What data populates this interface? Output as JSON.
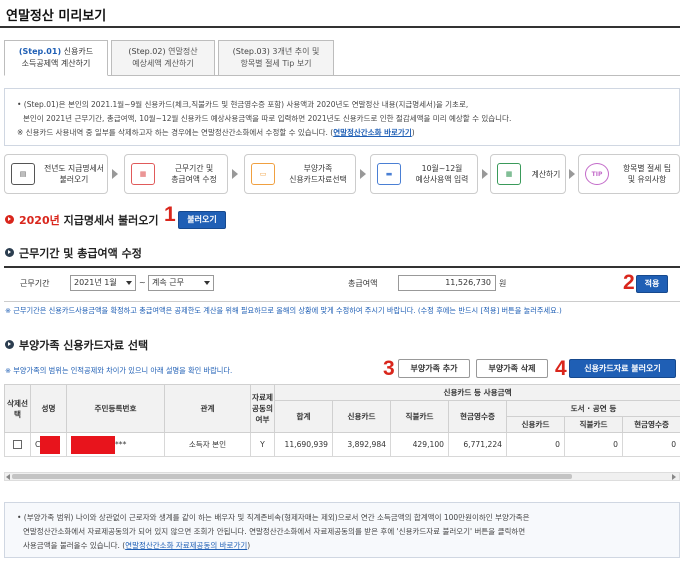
{
  "page": {
    "title": "연말정산 미리보기"
  },
  "tabs": [
    {
      "step": "(Step.01)",
      "label1": "신용카드",
      "label2": "소득공제액 계산하기"
    },
    {
      "step": "(Step.02)",
      "label1": "연말정산",
      "label2": "예상세액 계산하기"
    },
    {
      "step": "(Step.03)",
      "label1": "3개년 추이 및",
      "label2": "항목별 절세 Tip 보기"
    }
  ],
  "info": {
    "line1": "• (Step.01)은 본인의 2021.1월~9월 신용카드(체크,직불카드 및 현금영수증 포함) 사용액과 2020년도 연말정산 내용(지급명세서)을 기초로,",
    "line2": "본인이 2021년 근무기간, 총급여액, 10월~12월 신용카드 예상사용금액을 따로 입력하면 2021년도 신용카드로 인한 절감세액을 미리 예상할 수 있습니다.",
    "line3": "※ 신용카드 사용내역 중 일부를 삭제하고자 하는 경우에는 연말정산간소화에서 수정할 수 있습니다. (",
    "link": "연말정산간소화 바로가기",
    "line3_end": ")"
  },
  "flow": [
    {
      "label1": "전년도 지급명세서",
      "label2": "불러오기",
      "icon": "document-icon",
      "icon_text": "▤",
      "color": "#555555"
    },
    {
      "label1": "근무기간 및",
      "label2": "총급여액 수정",
      "icon": "calendar-icon",
      "icon_text": "▦",
      "color": "#e05a5a"
    },
    {
      "label1": "부양가족",
      "label2": "신용카드자료선택",
      "icon": "monitor-icon",
      "icon_text": "▭",
      "color": "#f0a040"
    },
    {
      "label1": "10월~12월",
      "label2": "예상사용액 입력",
      "icon": "card-icon",
      "icon_text": "▬",
      "color": "#4a7fd4"
    },
    {
      "label1": "계산하기",
      "label2": "",
      "icon": "calculator-icon",
      "icon_text": "▦",
      "color": "#3a9a5a"
    },
    {
      "label1": "항목별 절세 팁",
      "label2": "및 유의사항",
      "icon": "tip-icon",
      "icon_text": "TIP",
      "color": "#c36bc9"
    }
  ],
  "section1": {
    "year": "2020년",
    "title": "지급명세서 불러오기",
    "button": "불러오기",
    "marker": "1"
  },
  "section2": {
    "title": "근무기간 및 총급여액 수정",
    "period_label": "근무기간",
    "period_start": "2021년 1월",
    "tilde": "~",
    "period_end": "계속 근무",
    "salary_label": "총급여액",
    "salary_value": "11,526,730",
    "unit": "원",
    "apply_button": "적용",
    "marker": "2",
    "note": "※ 근무기간은 신용카드사용금액을 확정하고 총급여액은 공제한도 계산을 위해 필요하므로 올해의 상황에 맞게 수정하여 주시기 바랍니다. (수정 후에는 반드시 [적용] 버튼을 눌러주세요.)"
  },
  "section3": {
    "title": "부양가족 신용카드자료 선택",
    "note": "※ 부양가족의 범위는 인적공제와 차이가 있으니 아래 설명을 확인 바랍니다.",
    "add_button": "부양가족 추가",
    "delete_button": "부양가족 삭제",
    "load_button": "신용카드자료 불러오기",
    "marker3": "3",
    "marker4": "4"
  },
  "table": {
    "headers": {
      "select": "삭제선택",
      "name": "성명",
      "id": "주민등록번호",
      "relation": "관계",
      "provide": "자료제공동의여부",
      "usage_group": "신용카드 등 사용금액",
      "total": "합계",
      "credit": "신용카드",
      "debit": "직불카드",
      "cash": "현금영수증",
      "culture_group": "도서 · 공연 등",
      "c_credit": "신용카드",
      "c_debit": "직불카드",
      "c_cash": "현금영수증"
    },
    "rows": [
      {
        "name_prefix": "C",
        "id_suffix": "***",
        "relation": "소득자 본인",
        "provide": "Y",
        "total": "11,690,939",
        "credit": "3,892,984",
        "debit": "429,100",
        "cash": "6,771,224",
        "c_credit": "0",
        "c_debit": "0",
        "c_cash": "0"
      }
    ]
  },
  "bottom": {
    "line1": "• (부양가족 범위) 나이와 상관없이 근로자와 생계를 같이 하는 배우자 및 직계존비속(형제자매는 제외)으로서 연간 소득금액의 합계액이 100만원이하인 부양가족은",
    "line2": "연말정산간소화에서 자료제공동의가 되어 있지 않으면 조회가 안됩니다. 연말정산간소화에서 자료제공동의를 받은 후에 '신용카드자료 불러오기' 버튼을 클릭하면",
    "line3": "사용금액을 불러올수 있습니다. (",
    "link": "연말정산간소화 자료제공동의 바로가기",
    "line3_end": ")"
  }
}
